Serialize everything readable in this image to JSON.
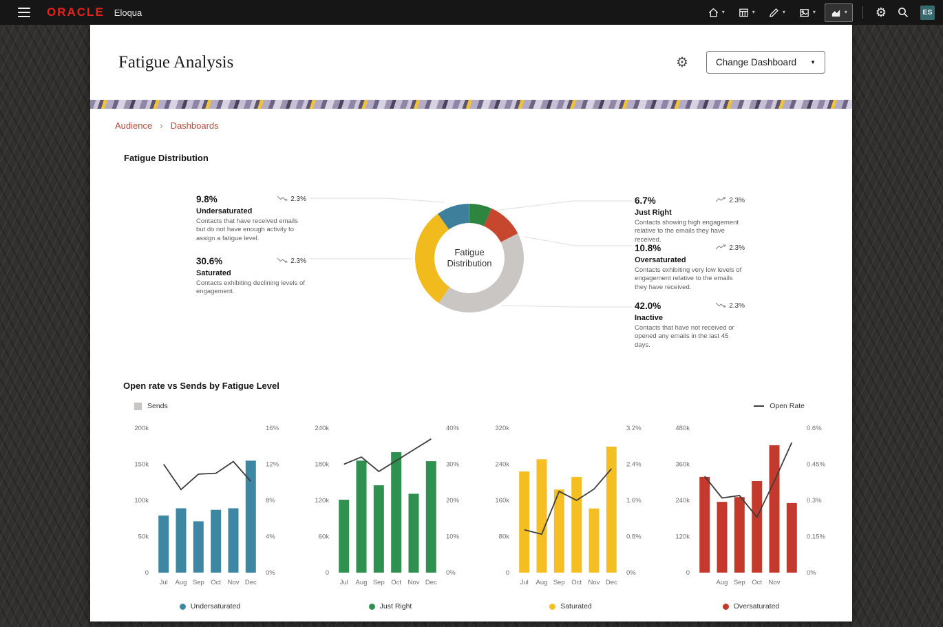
{
  "topbar": {
    "brand": "ORACLE",
    "app": "Eloqua",
    "user_badge": "ES"
  },
  "header": {
    "title": "Fatigue Analysis",
    "change_dashboard": "Change Dashboard"
  },
  "breadcrumb": {
    "level1": "Audience",
    "level2": "Dashboards"
  },
  "colors": {
    "brand_red": "#e5231b",
    "link_red": "#b6493a",
    "avatar_teal": "#356b6e",
    "sends_gray": "#c9c4bf",
    "open_rate_line": "#3c3c3c"
  },
  "distribution": {
    "section_title": "Fatigue Distribution",
    "center_label_line1": "Fatigue",
    "center_label_line2": "Distribution",
    "left_stats": [
      {
        "pct": "9.8%",
        "trend": "2.3%",
        "dir": "down",
        "name": "Undersaturated",
        "desc": "Contacts that have received emails but do not have enough activity to assign a fatigue level."
      },
      {
        "pct": "30.6%",
        "trend": "2.3%",
        "dir": "down",
        "name": "Saturated",
        "desc": "Contacts exhibiting declining levels of engagement."
      }
    ],
    "right_stats": [
      {
        "pct": "6.7%",
        "trend": "2.3%",
        "dir": "up",
        "name": "Just Right",
        "desc": "Contacts showing high engagement relative to the emails they have received."
      },
      {
        "pct": "10.8%",
        "trend": "2.3%",
        "dir": "up",
        "name": "Oversaturated",
        "desc": "Contacts exhibiting very low levels of engagement relative to the emails they have received."
      },
      {
        "pct": "42.0%",
        "trend": "2.3%",
        "dir": "down",
        "name": "Inactive",
        "desc": "Contacts that have not received or opened any emails in the last 45 days."
      }
    ]
  },
  "open_rate_section": {
    "title": "Open rate vs Sends by Fatigue Level",
    "legend_sends": "Sends",
    "legend_open_rate": "Open Rate"
  },
  "chart_data": [
    {
      "type": "pie",
      "title": "Fatigue Distribution",
      "labels": [
        "Just Right",
        "Oversaturated",
        "Inactive",
        "Saturated",
        "Undersaturated"
      ],
      "values": [
        6.7,
        10.8,
        42.0,
        30.6,
        9.8
      ],
      "colors": [
        "#2e8540",
        "#c7472e",
        "#c9c6c4",
        "#f2bb1d",
        "#3e7f9c"
      ],
      "inner_radius_ratio": 0.64
    },
    {
      "type": "bar",
      "name": "Undersaturated",
      "color": "#3e87a3",
      "categories": [
        "Jul",
        "Aug",
        "Sep",
        "Oct",
        "Nov",
        "Dec"
      ],
      "series": [
        {
          "name": "Sends",
          "axis": "left",
          "values": [
            79000,
            89000,
            71000,
            87000,
            89000,
            155000
          ]
        },
        {
          "name": "Open Rate",
          "axis": "right",
          "type": "line",
          "values": [
            12,
            9.2,
            10.9,
            11,
            12.3,
            10.1
          ]
        }
      ],
      "left_axis": {
        "min": 0,
        "max": 200000,
        "tick_labels": [
          "200k",
          "150k",
          "100k",
          "50k",
          "0"
        ]
      },
      "right_axis": {
        "min": 0,
        "max": 16,
        "tick_labels": [
          "16%",
          "12%",
          "8%",
          "4%",
          "0%"
        ]
      }
    },
    {
      "type": "bar",
      "name": "Just Right",
      "color": "#2e9150",
      "categories": [
        "Jul",
        "Aug",
        "Sep",
        "Oct",
        "Nov",
        "Dec"
      ],
      "series": [
        {
          "name": "Sends",
          "axis": "left",
          "values": [
            121000,
            186000,
            145000,
            200000,
            131000,
            185000
          ]
        },
        {
          "name": "Open Rate",
          "axis": "right",
          "type": "line",
          "values": [
            30,
            32,
            28,
            31,
            34,
            37
          ]
        }
      ],
      "left_axis": {
        "min": 0,
        "max": 240000,
        "tick_labels": [
          "240k",
          "180k",
          "120k",
          "60k",
          "0"
        ]
      },
      "right_axis": {
        "min": 0,
        "max": 40,
        "tick_labels": [
          "40%",
          "30%",
          "20%",
          "10%",
          "0%"
        ]
      }
    },
    {
      "type": "bar",
      "name": "Saturated",
      "color": "#f5bf24",
      "categories": [
        "Jul",
        "Aug",
        "Sep",
        "Oct",
        "Nov",
        "Dec"
      ],
      "series": [
        {
          "name": "Sends",
          "axis": "left",
          "values": [
            224000,
            251000,
            184000,
            212000,
            142000,
            279000
          ]
        },
        {
          "name": "Open Rate",
          "axis": "right",
          "type": "line",
          "values": [
            0.95,
            0.85,
            1.8,
            1.6,
            1.85,
            2.3
          ]
        }
      ],
      "left_axis": {
        "min": 0,
        "max": 320000,
        "tick_labels": [
          "320k",
          "240k",
          "160k",
          "80k",
          "0"
        ]
      },
      "right_axis": {
        "min": 0,
        "max": 3.2,
        "tick_labels": [
          "3.2%",
          "2.4%",
          "1.6%",
          "0.8%",
          "0%"
        ]
      }
    },
    {
      "type": "bar",
      "name": "Oversaturated",
      "color": "#c33a2c",
      "categories": [
        "",
        "Aug",
        "Sep",
        "Oct",
        "Nov",
        ""
      ],
      "series": [
        {
          "name": "Sends",
          "axis": "left",
          "values": [
            318000,
            235000,
            251000,
            304000,
            423000,
            231000
          ]
        },
        {
          "name": "Open Rate",
          "axis": "right",
          "type": "line",
          "values": [
            0.4,
            0.31,
            0.32,
            0.23,
            0.38,
            0.54
          ]
        }
      ],
      "left_axis": {
        "min": 0,
        "max": 480000,
        "tick_labels": [
          "480k",
          "360k",
          "240k",
          "120k",
          "0"
        ]
      },
      "right_axis": {
        "min": 0,
        "max": 0.6,
        "tick_labels": [
          "0.6%",
          "0.45%",
          "0.3%",
          "0.15%",
          "0%"
        ]
      }
    }
  ]
}
